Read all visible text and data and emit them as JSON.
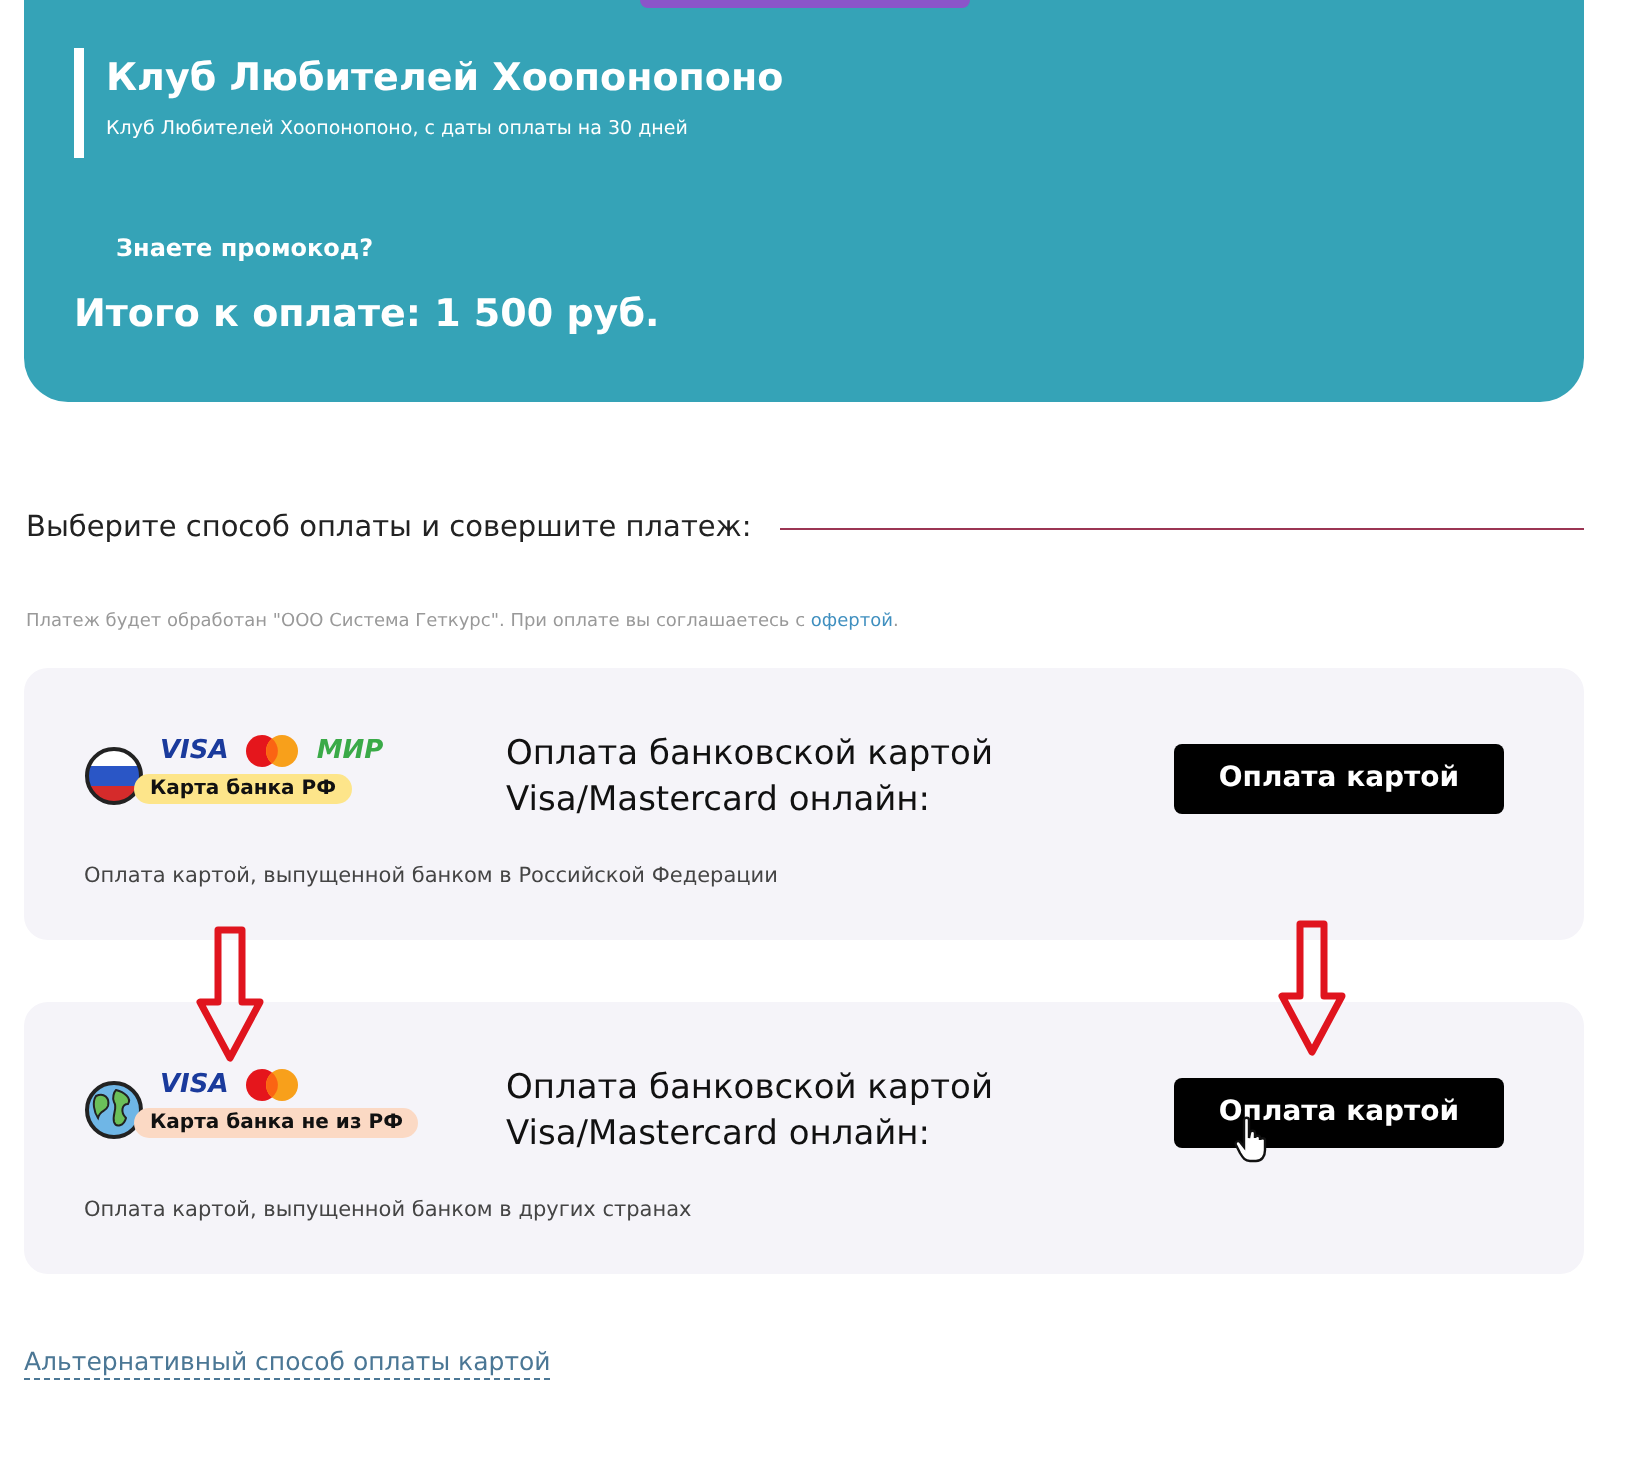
{
  "order": {
    "title": "Клуб Любителей Хоопонопоно",
    "subtitle": "Клуб Любителей Хоопонопоно, с даты оплаты на 30 дней",
    "promo_link": "Знаете промокод?",
    "total": "Итого к оплате: 1 500 руб."
  },
  "payment": {
    "heading": "Выберите способ оплаты и совершите платеж:",
    "note_before": "Платеж будет обработан \"ООО Система Геткурс\". При оплате вы соглашаетесь с ",
    "note_link": "офертой",
    "note_after": ".",
    "methods": [
      {
        "kind": "russia",
        "brands": [
          {
            "kind": "visa",
            "label": "VISA"
          },
          {
            "kind": "mastercard"
          },
          {
            "kind": "mir",
            "label": "МИР"
          }
        ],
        "badge": {
          "label": "Карта банка РФ",
          "color": "#fde58a"
        },
        "title": "Оплата банковской картой Visa/Mastercard онлайн:",
        "button": "Оплата картой",
        "description": "Оплата картой, выпущенной банком в Российской Федерации",
        "hovered": false
      },
      {
        "kind": "globe",
        "brands": [
          {
            "kind": "visa",
            "label": "VISA"
          },
          {
            "kind": "mastercard"
          }
        ],
        "badge": {
          "label": "Карта банка не из РФ",
          "color": "#fbd9c4"
        },
        "title": "Оплата банковской картой Visa/Mastercard онлайн:",
        "button": "Оплата картой",
        "description": "Оплата картой, выпущенной банком в других странах",
        "hovered": true
      }
    ]
  },
  "alt_link": "Альтернативный способ оплаты картой"
}
